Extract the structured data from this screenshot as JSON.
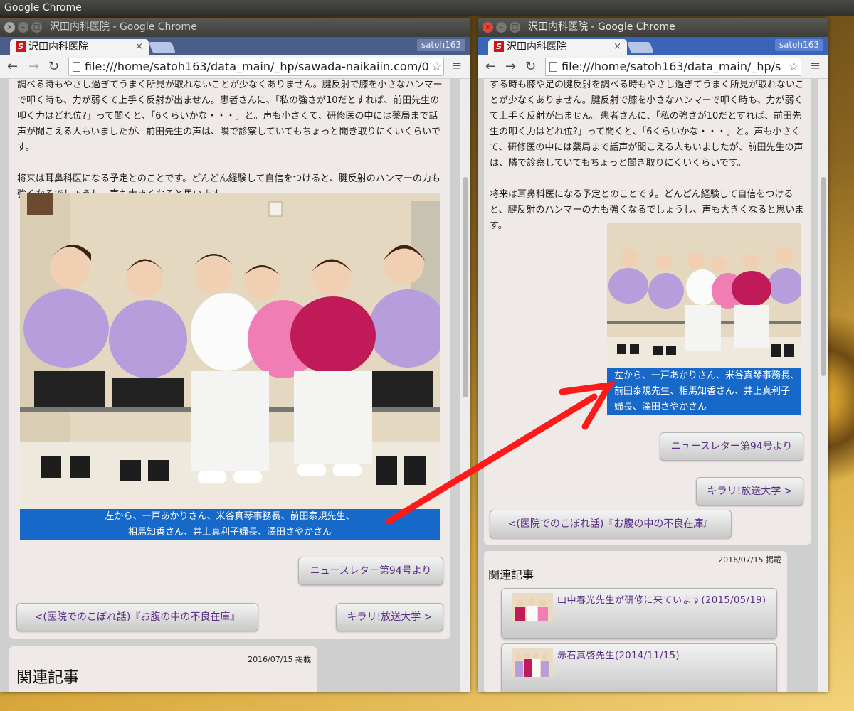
{
  "desktop": {
    "title": "Google Chrome"
  },
  "window_title": "沢田内科医院 - Google Chrome",
  "tab_title": "沢田内科医院",
  "tab_favicon": "S",
  "profile_name": "satoh163",
  "left_url": "file:///home/satoh163/data_main/_hp/sawada-naikaiin.com/0",
  "right_url": "file:///home/satoh163/data_main/_hp/s",
  "icons": {
    "back": "←",
    "forward": "→",
    "reload": "↻",
    "star": "☆",
    "menu": "≡",
    "close": "×"
  },
  "left_paragraphs": [
    "調べる時もやさし過ぎてうまく所見が取れないことが少なくありません。腱反射で膝を小さなハンマーで叩く時も、力が弱くて上手く反射が出ません。患者さんに、「私の強さが10だとすれば、前田先生の叩く力はどれ位?」って聞くと、「6くらいかな・・・」と。声も小さくて、研修医の中には薬局まで話声が聞こえる人もいましたが、前田先生の声は、隣で診察していてもちょっと聞き取りにくいくらいです。",
    "将来は耳鼻科医になる予定とのことです。どんどん経験して自信をつけると、腱反射のハンマーの力も強くなるでしょうし、声も大きくなると思います。"
  ],
  "right_paragraphs": [
    "する時も膝や足の腱反射を調べる時もやさし過ぎてうまく所見が取れないことが少なくありません。腱反射で膝を小さなハンマーで叩く時も、力が弱くて上手く反射が出ません。患者さんに、「私の強さが10だとすれば、前田先生の叩く力はどれ位?」って聞くと、「6くらいかな・・・」と。声も小さくて、研修医の中には薬局まで話声が聞こえる人もいましたが、前田先生の声は、隣で診察していてもちょっと聞き取りにくいくらいです。",
    "将来は耳鼻科医になる予定とのことです。どんどん経験して自信をつけると、腱反射のハンマーの力も強くなるでしょうし、声も大きくなると思います。"
  ],
  "caption_left": [
    "左から、一戸あかりさん、米谷真琴事務長、前田泰規先生、",
    "相馬知香さん、井上真利子婦長、澤田さやかさん"
  ],
  "caption_right": [
    "左から、一戸あかりさん、米谷真琴事務長、",
    "前田泰規先生、相馬知香さん、井上真利子",
    "婦長、澤田さやかさん"
  ],
  "buttons": {
    "newsletter": "ニュースレター第94号より",
    "prev": "<(医院でのこぼれ話)『お腹の中の不良在庫』",
    "next": "キラリ!放送大学 >"
  },
  "posted": "2016/07/15 掲載",
  "related_heading": "関連記事",
  "related_items": [
    {
      "label": "山中春光先生が研修に来ています(2015/05/19)"
    },
    {
      "label": "赤石真啓先生(2014/11/15)"
    }
  ],
  "colors": {
    "caption_bg": "#1769c9",
    "button_text": "#5a2d86",
    "annotation_arrow": "#ff1a1a"
  }
}
